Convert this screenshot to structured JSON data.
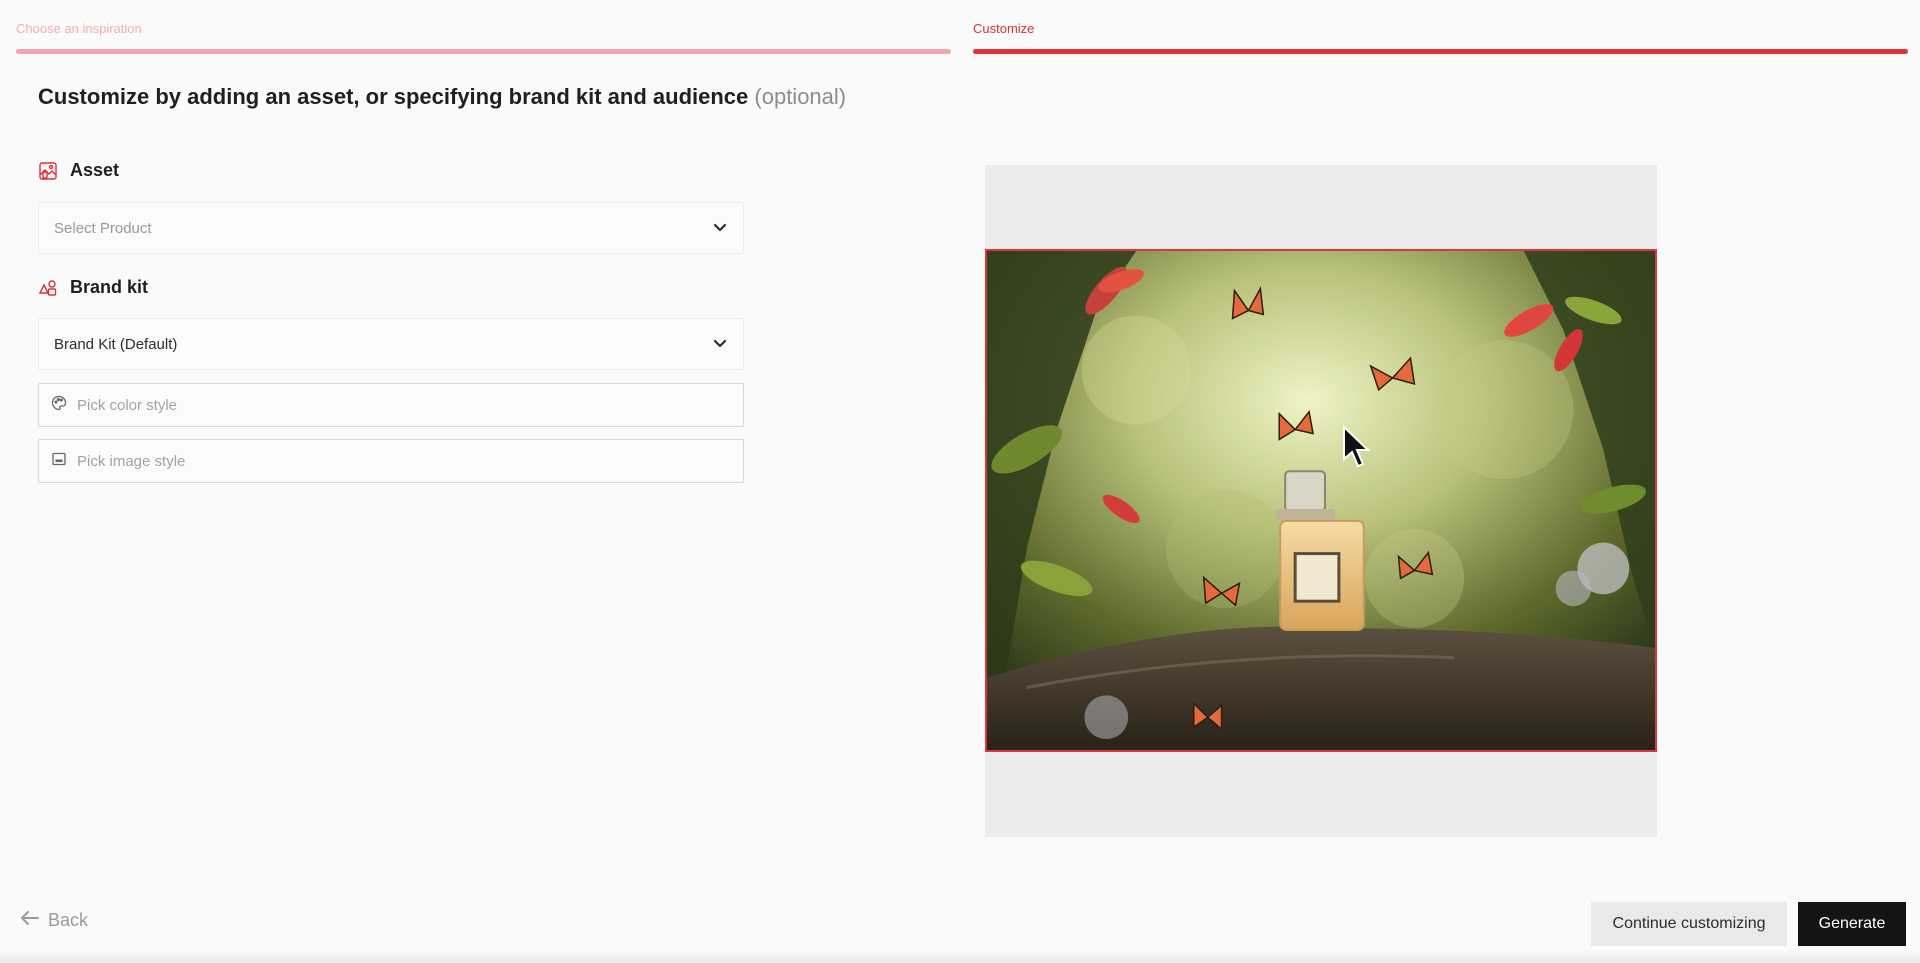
{
  "stepper": {
    "steps": [
      {
        "label": "Choose an inspiration"
      },
      {
        "label": "Customize"
      }
    ]
  },
  "heading": {
    "title": "Customize by adding an asset, or specifying brand kit and audience",
    "optional": "(optional)"
  },
  "asset": {
    "label": "Asset",
    "icon": "image-asset-icon",
    "select_placeholder": "Select Product"
  },
  "brand_kit": {
    "label": "Brand kit",
    "icon": "shapes-icon",
    "select_value": "Brand Kit (Default)",
    "color_style_placeholder": "Pick color style",
    "image_style_placeholder": "Pick image style"
  },
  "footer": {
    "back_label": "Back",
    "continue_label": "Continue customizing",
    "generate_label": "Generate"
  },
  "colors": {
    "accent": "#e3323c",
    "accent_light": "#f2a6ab",
    "primary_button": "#141414"
  }
}
